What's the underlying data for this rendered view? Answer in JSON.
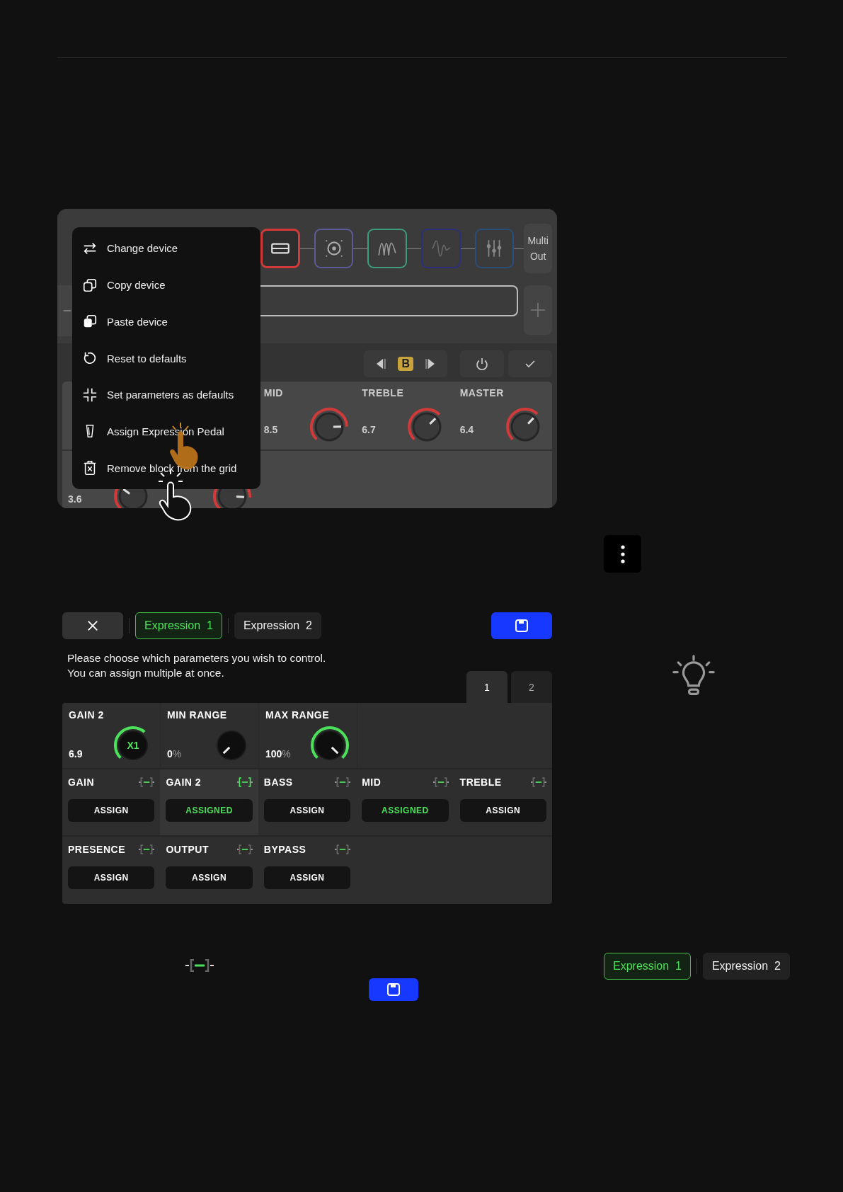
{
  "editor": {
    "chain": [
      {
        "kind": "amp",
        "color": "#d23a3a",
        "selected": true
      },
      {
        "kind": "speaker",
        "color": "#5e5a9a",
        "selected": false
      },
      {
        "kind": "zigzag",
        "color": "#3f9c7a",
        "selected": false
      },
      {
        "kind": "wave",
        "color": "#2c2f7a",
        "selected": false
      },
      {
        "kind": "mixer",
        "color": "#2a4e7a",
        "selected": false
      }
    ],
    "output_label": "Multi Out",
    "variant": "B",
    "params": [
      {
        "name": "MID",
        "value": "8.5"
      },
      {
        "name": "TREBLE",
        "value": "6.7"
      },
      {
        "name": "MASTER",
        "value": "6.4"
      }
    ],
    "row_2_value": "3.6"
  },
  "context_menu": [
    {
      "kind": "swap",
      "label": "Change device"
    },
    {
      "kind": "copy",
      "label": "Copy device"
    },
    {
      "kind": "paste",
      "label": "Paste device"
    },
    {
      "kind": "reset",
      "label": "Reset to defaults"
    },
    {
      "kind": "collapse",
      "label": "Set parameters as defaults"
    },
    {
      "kind": "pedal",
      "label": "Assign Expression Pedal"
    },
    {
      "kind": "delete",
      "label": "Remove block from the grid"
    }
  ],
  "expression": {
    "tabs": [
      {
        "label": "Expression  1",
        "selected": true
      },
      {
        "label": "Expression  2",
        "selected": false
      }
    ],
    "hint": [
      "Please choose which parameters you wish to control.",
      "You can assign multiple at once."
    ],
    "pages": [
      {
        "label": "1",
        "selected": true
      },
      {
        "label": "2",
        "selected": false
      }
    ],
    "controls": [
      {
        "name": "GAIN 2",
        "value": "6.9",
        "badge": "X1"
      },
      {
        "name": "MIN RANGE",
        "value": "0",
        "unit": "%"
      },
      {
        "name": "MAX RANGE",
        "value": "100",
        "unit": "%"
      }
    ],
    "parameters": [
      {
        "name": "GAIN",
        "action": "ASSIGN",
        "assigned": false,
        "selected": false
      },
      {
        "name": "GAIN 2",
        "action": "ASSIGNED",
        "assigned": true,
        "selected": true
      },
      {
        "name": "BASS",
        "action": "ASSIGN",
        "assigned": false,
        "selected": false
      },
      {
        "name": "MID",
        "action": "ASSIGNED",
        "assigned": true,
        "selected": false
      },
      {
        "name": "TREBLE",
        "action": "ASSIGN",
        "assigned": false,
        "selected": false
      },
      {
        "name": "PRESENCE",
        "action": "ASSIGN",
        "assigned": false,
        "selected": false
      },
      {
        "name": "OUTPUT",
        "action": "ASSIGN",
        "assigned": false,
        "selected": false
      },
      {
        "name": "BYPASS",
        "action": "ASSIGN",
        "assigned": false,
        "selected": false
      }
    ]
  },
  "samples": {
    "tabs": [
      {
        "label": "Expression  1",
        "selected": true
      },
      {
        "label": "Expression  2",
        "selected": false
      }
    ]
  }
}
